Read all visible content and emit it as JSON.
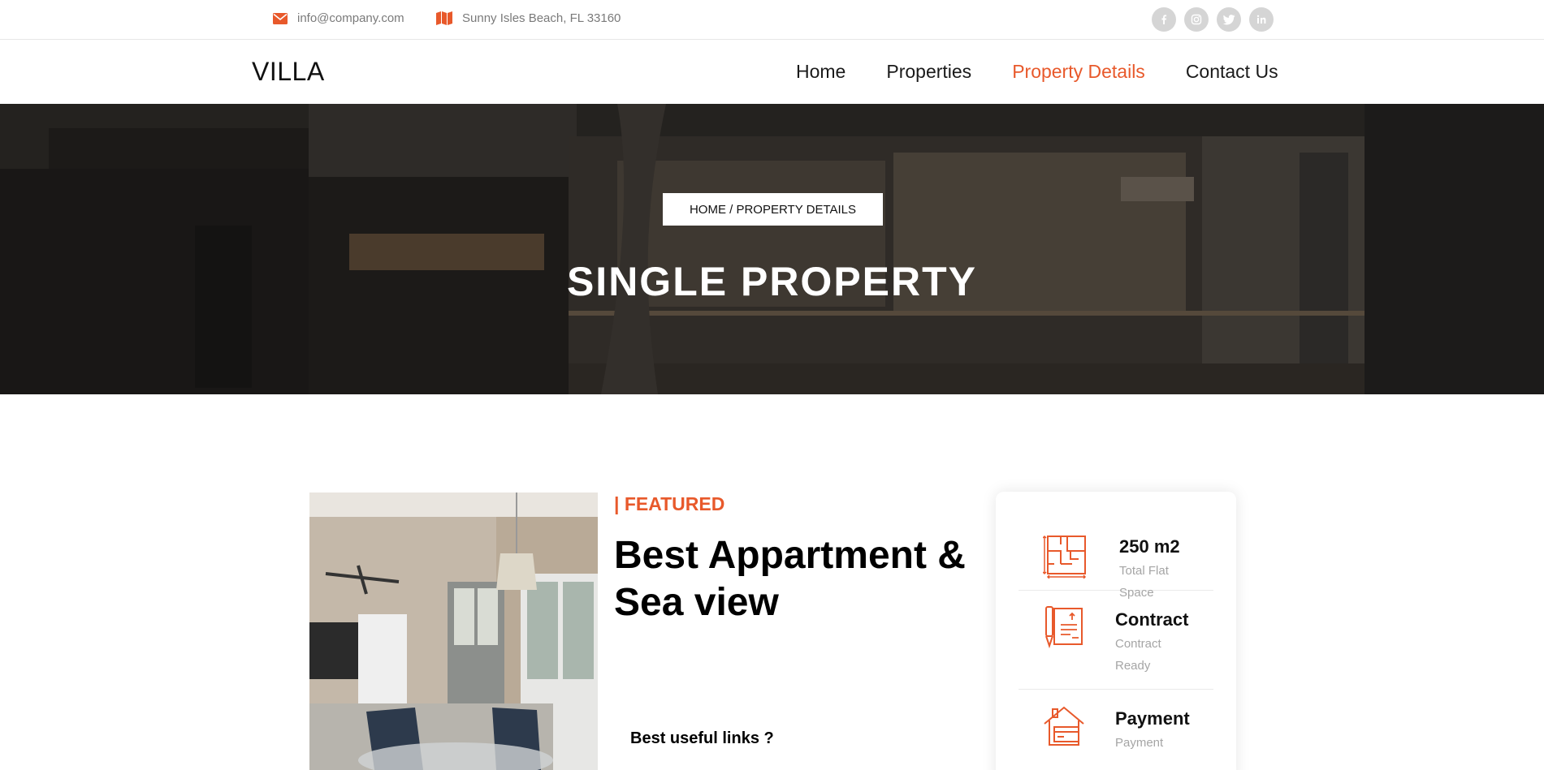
{
  "topbar": {
    "email": "info@company.com",
    "address": "Sunny Isles Beach, FL 33160",
    "socials": [
      "facebook-icon",
      "instagram-icon",
      "twitter-icon",
      "linkedin-icon"
    ]
  },
  "header": {
    "logo": "VILLA",
    "nav": [
      {
        "label": "Home",
        "active": false
      },
      {
        "label": "Properties",
        "active": false
      },
      {
        "label": "Property Details",
        "active": true
      },
      {
        "label": "Contact Us",
        "active": false
      }
    ]
  },
  "hero": {
    "breadcrumb": "HOME / PROPERTY DETAILS",
    "title": "SINGLE PROPERTY"
  },
  "property": {
    "featured": "| FEATURED",
    "title": "Best Appartment & Sea view",
    "links_question": "Best useful links ?"
  },
  "info": [
    {
      "value": "250 m2",
      "sub_line1": "Total Flat",
      "sub_line2": "Space",
      "icon": "floor-plan-icon"
    },
    {
      "value": "Contract",
      "sub_line1": "Contract",
      "sub_line2": "Ready",
      "icon": "contract-icon"
    },
    {
      "value": "Payment",
      "sub_line1": "Payment",
      "sub_line2": "",
      "icon": "payment-house-icon"
    }
  ],
  "colors": {
    "accent": "#e8592b",
    "social_bg": "#d5d5d5",
    "muted_text": "#a5a5a5"
  }
}
